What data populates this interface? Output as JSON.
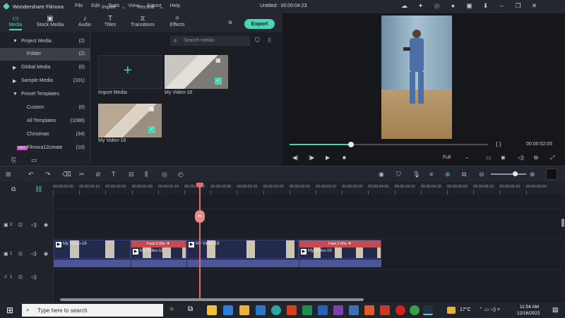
{
  "app": {
    "name": "Wondershare Filmora",
    "title": "Untitled : 00:00:04:23"
  },
  "menu": [
    "File",
    "Edit",
    "Tools",
    "View",
    "Export",
    "Help"
  ],
  "tabs": [
    {
      "label": "Media",
      "icon": "folder-icon",
      "active": true
    },
    {
      "label": "Stock Media",
      "icon": "camera-icon",
      "active": false
    },
    {
      "label": "Audio",
      "icon": "music-icon",
      "active": false
    },
    {
      "label": "Titles",
      "icon": "text-icon",
      "active": false
    },
    {
      "label": "Transitions",
      "icon": "transition-icon",
      "active": false
    },
    {
      "label": "Effects",
      "icon": "effects-icon",
      "active": false
    }
  ],
  "export_label": "Export",
  "sidebar": [
    {
      "label": "Project Media",
      "count": "(2)",
      "indent": 1,
      "arrow": "▼"
    },
    {
      "label": "Folder",
      "count": "(2)",
      "indent": 2,
      "arrow": "",
      "selected": true
    },
    {
      "label": "Global Media",
      "count": "(0)",
      "indent": 1,
      "arrow": "▶"
    },
    {
      "label": "Sample Media",
      "count": "(101)",
      "indent": 1,
      "arrow": "▶"
    },
    {
      "label": "Preset Templates",
      "count": "",
      "indent": 1,
      "arrow": "▼"
    },
    {
      "label": "Custom",
      "count": "(0)",
      "indent": 2,
      "arrow": ""
    },
    {
      "label": "All Templates",
      "count": "(1086)",
      "indent": 2,
      "arrow": ""
    },
    {
      "label": "Christmas",
      "count": "(34)",
      "indent": 2,
      "arrow": ""
    },
    {
      "label": "Filmora12create",
      "count": "(10)",
      "indent": 1,
      "arrow": "",
      "badge": "HOT"
    }
  ],
  "media_toolbar": {
    "import": "Import",
    "record": "Record",
    "search_placeholder": "Search media"
  },
  "media_items": [
    {
      "label": "Import Media"
    },
    {
      "label": "My Video-18"
    },
    {
      "label": "My Video-19"
    }
  ],
  "preview": {
    "timecode": "00:00:02:05",
    "progress": 0.31,
    "quality": "Full",
    "braces": "{   }"
  },
  "ruler_labels": [
    "00:00:00:00",
    "00:00:00:10",
    "00:00:00:20",
    "00:00:01:00",
    "00:00:01:10",
    "00:00:01:20",
    "00:00:02:00",
    "00:00:02:10",
    "00:00:02:20",
    "00:00:03:00",
    "00:00:03:10",
    "00:00:03:20",
    "00:00:04:00",
    "00:00:04:10",
    "00:00:04:20",
    "00:00:05:00",
    "00:00:05:10",
    "00:00:05:20",
    "00:00:06:00"
  ],
  "tracks": [
    {
      "label": "2"
    },
    {
      "label": "1"
    },
    {
      "label": "1"
    }
  ],
  "clips": [
    {
      "name": "My Video-18"
    },
    {
      "name": "My Video-18"
    },
    {
      "name": "My Video-19"
    },
    {
      "name": "My Video-19"
    }
  ],
  "speeds": [
    "Fast 2.00x ▼",
    "Fast 2.00x ▼"
  ],
  "taskbar": {
    "search": "Type here to search",
    "weather": "17°C",
    "time": "11:54 AM",
    "date": "12/16/2022"
  },
  "colors": {
    "accent": "#4ed3b4",
    "playhead": "#e56a6a",
    "speed": "#c44b50",
    "audio": "#4e5597"
  }
}
